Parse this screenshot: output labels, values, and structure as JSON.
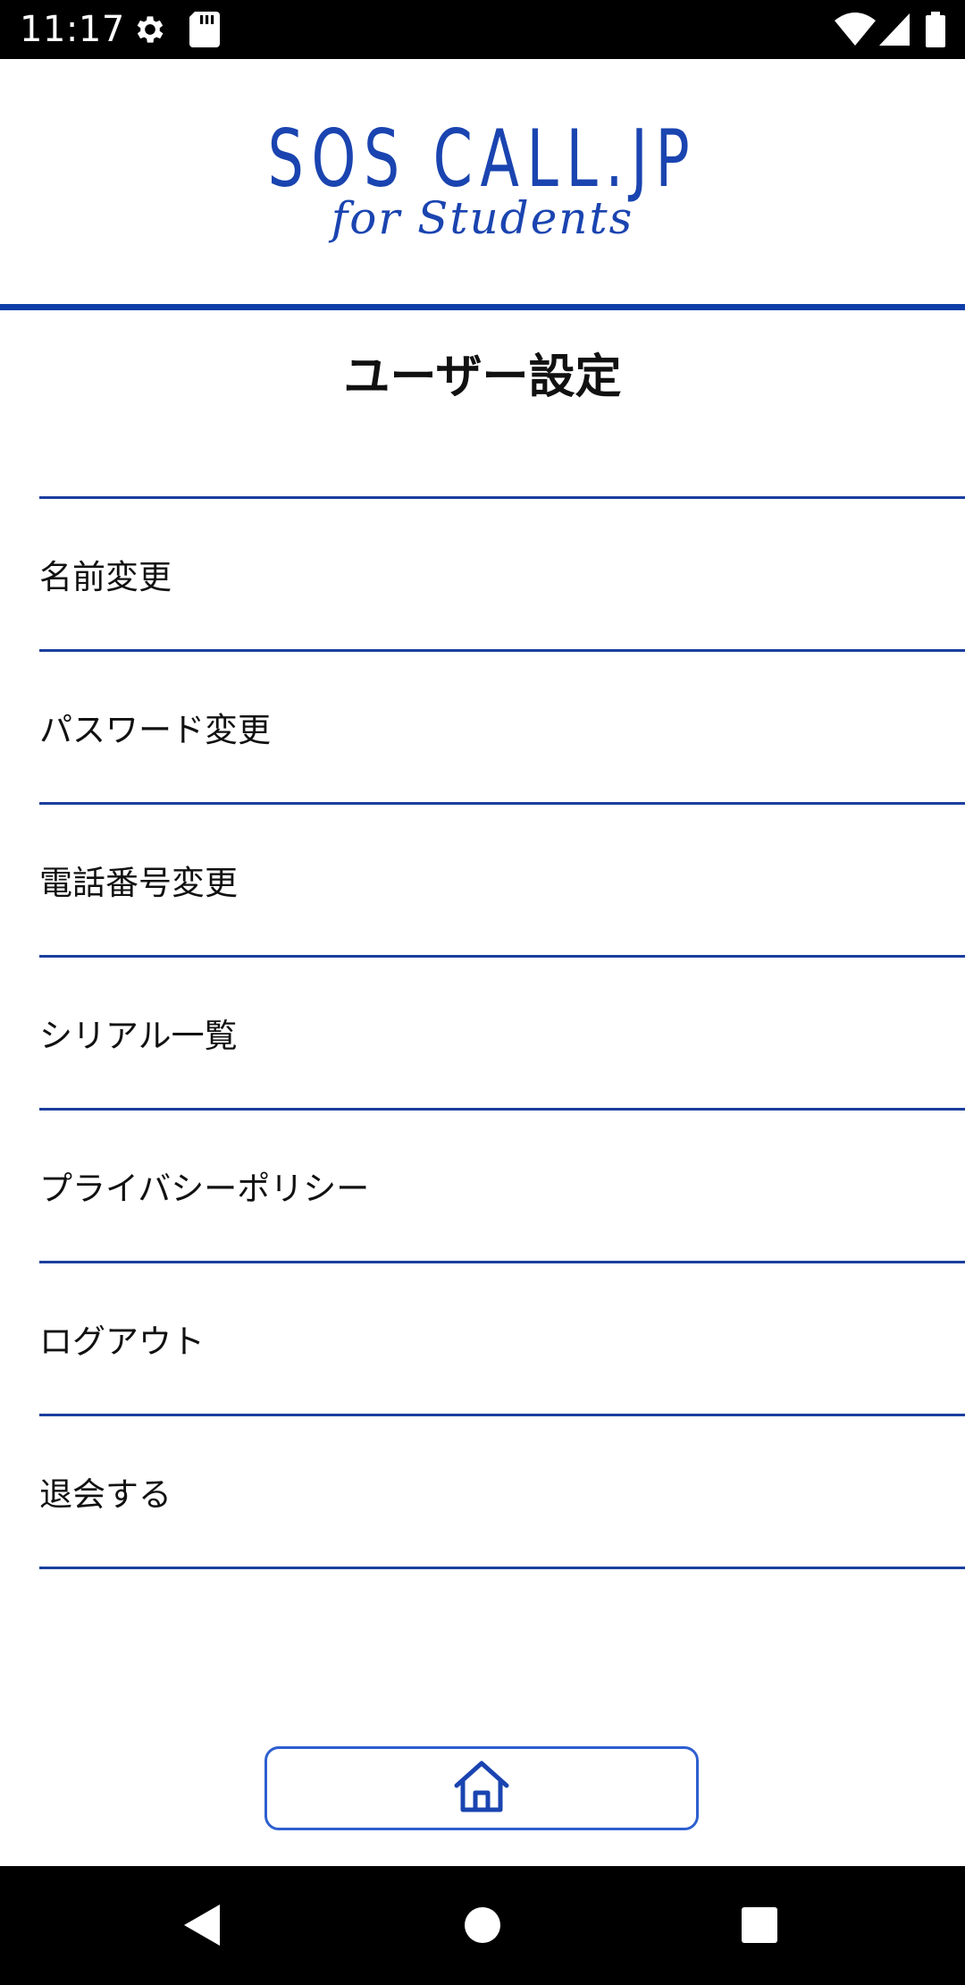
{
  "status_bar": {
    "time": "11:17",
    "icons": [
      "gear-icon",
      "sd-card-icon",
      "wifi-icon",
      "signal-icon",
      "battery-icon"
    ]
  },
  "header": {
    "logo_main": "SOS CALL.JP",
    "logo_sub": "for Students",
    "brand_color": "#1a44b0"
  },
  "page": {
    "title": "ユーザー設定"
  },
  "menu": {
    "items": [
      {
        "label": "名前変更"
      },
      {
        "label": "パスワード変更"
      },
      {
        "label": "電話番号変更"
      },
      {
        "label": "シリアル一覧"
      },
      {
        "label": "プライバシーポリシー"
      },
      {
        "label": "ログアウト"
      },
      {
        "label": "退会する"
      }
    ],
    "divider_color": "#1a3f9e"
  },
  "footer": {
    "home_icon": "home-icon"
  },
  "nav_bar": {
    "icons": [
      "back-icon",
      "home-circle-icon",
      "recents-icon"
    ]
  }
}
